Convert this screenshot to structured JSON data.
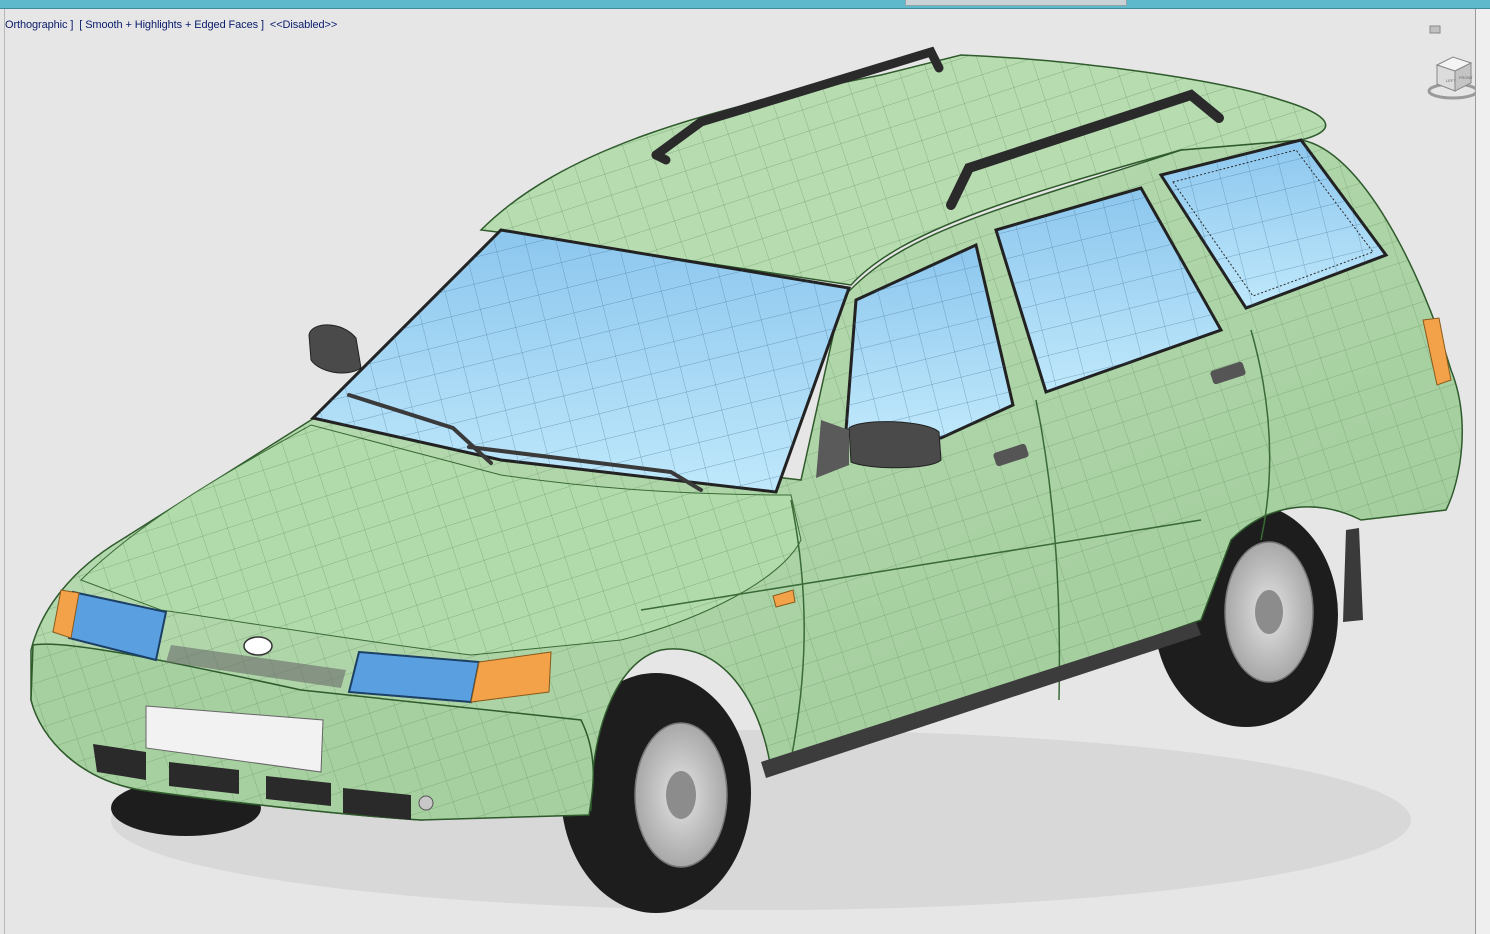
{
  "viewport": {
    "label_parts": [
      "Orthographic ]",
      "[ Smooth + Highlights + Edged Faces ]",
      "<<Disabled>>"
    ]
  },
  "viewcube": {
    "faces": [
      "LEFT",
      "FRONT"
    ],
    "icon": "viewcube-icon"
  },
  "colors": {
    "body": "#a8d3a2",
    "glass": "#9ed4f2",
    "headlight": "#5aa0e0",
    "indicator": "#f3a24a",
    "tire": "#1d1d1d",
    "wheel": "#c7c7c7",
    "trim": "#3c3c3c",
    "background": "#e6e6e6"
  }
}
